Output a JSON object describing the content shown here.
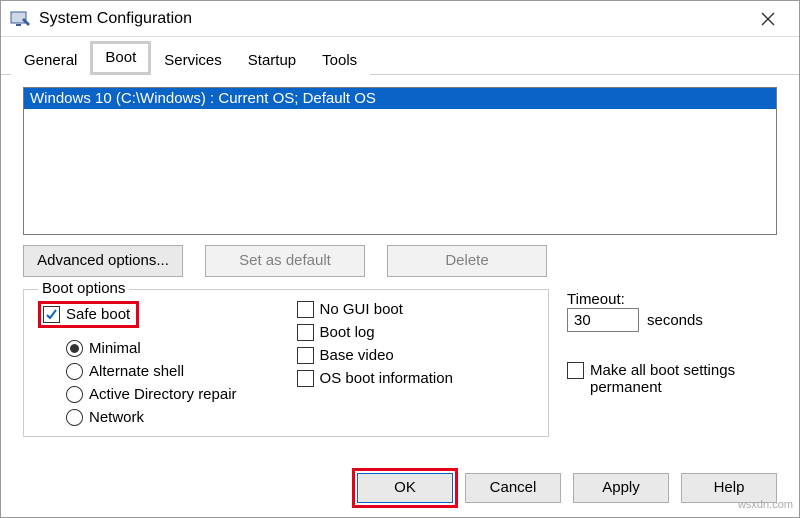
{
  "window": {
    "title": "System Configuration"
  },
  "tabs": {
    "general": "General",
    "boot": "Boot",
    "services": "Services",
    "startup": "Startup",
    "tools": "Tools"
  },
  "os_list": {
    "item0": "Windows 10 (C:\\Windows) : Current OS; Default OS"
  },
  "buttons": {
    "advanced": "Advanced options...",
    "set_default": "Set as default",
    "delete": "Delete",
    "ok": "OK",
    "cancel": "Cancel",
    "apply": "Apply",
    "help": "Help"
  },
  "boot_options": {
    "legend": "Boot options",
    "safe_boot": "Safe boot",
    "minimal": "Minimal",
    "alt_shell": "Alternate shell",
    "ad_repair": "Active Directory repair",
    "network": "Network",
    "no_gui": "No GUI boot",
    "boot_log": "Boot log",
    "base_video": "Base video",
    "os_info": "OS boot information"
  },
  "timeout": {
    "label": "Timeout:",
    "value": "30",
    "unit": "seconds"
  },
  "permanent": "Make all boot settings permanent"
}
